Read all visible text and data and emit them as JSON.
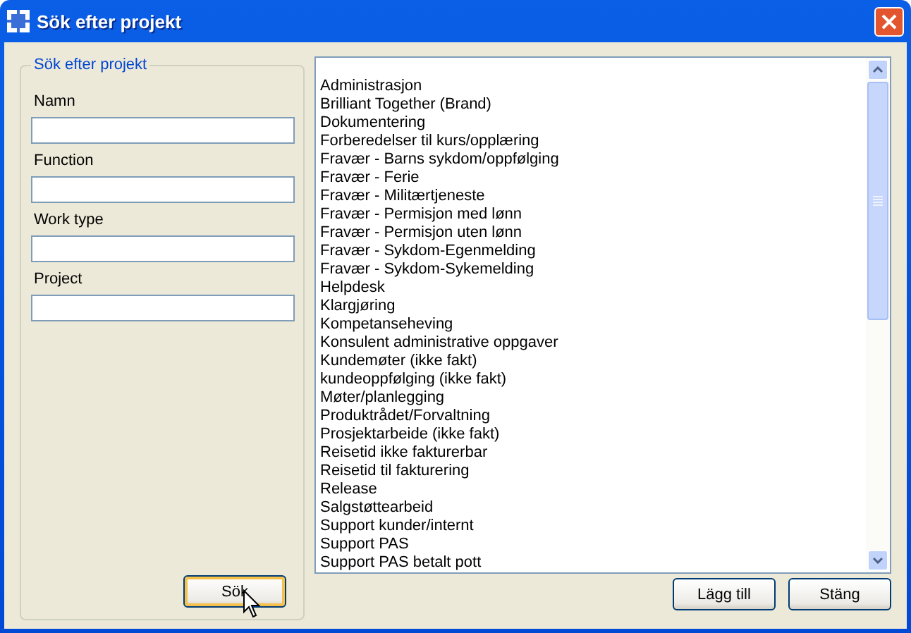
{
  "window": {
    "title": "Sök efter projekt"
  },
  "search_group": {
    "title": "Sök efter projekt",
    "fields": [
      {
        "label": "Namn"
      },
      {
        "label": "Function"
      },
      {
        "label": "Work type"
      },
      {
        "label": "Project"
      }
    ],
    "search_button": "Sök"
  },
  "project_list": {
    "items": [
      "Administrasjon",
      "Brilliant Together (Brand)",
      "Dokumentering",
      "Forberedelser til kurs/opplæring",
      "Fravær - Barns sykdom/oppfølging",
      "Fravær - Ferie",
      "Fravær - Militærtjeneste",
      "Fravær - Permisjon med lønn",
      "Fravær - Permisjon uten lønn",
      "Fravær - Sykdom-Egenmelding",
      "Fravær - Sykdom-Sykemelding",
      "Helpdesk",
      "Klargjøring",
      "Kompetanseheving",
      "Konsulent administrative oppgaver",
      "Kundemøter (ikke fakt)",
      "kundeoppfølging (ikke fakt)",
      "Møter/planlegging",
      "Produktrådet/Forvaltning",
      "Prosjektarbeide (ikke fakt)",
      "Reisetid ikke fakturerbar",
      "Reisetid til fakturering",
      "Release",
      "Salgstøttearbeid",
      "Support kunder/internt",
      "Support PAS",
      "Support PAS betalt pott"
    ]
  },
  "buttons": [
    "Lägg till",
    "Stäng"
  ]
}
